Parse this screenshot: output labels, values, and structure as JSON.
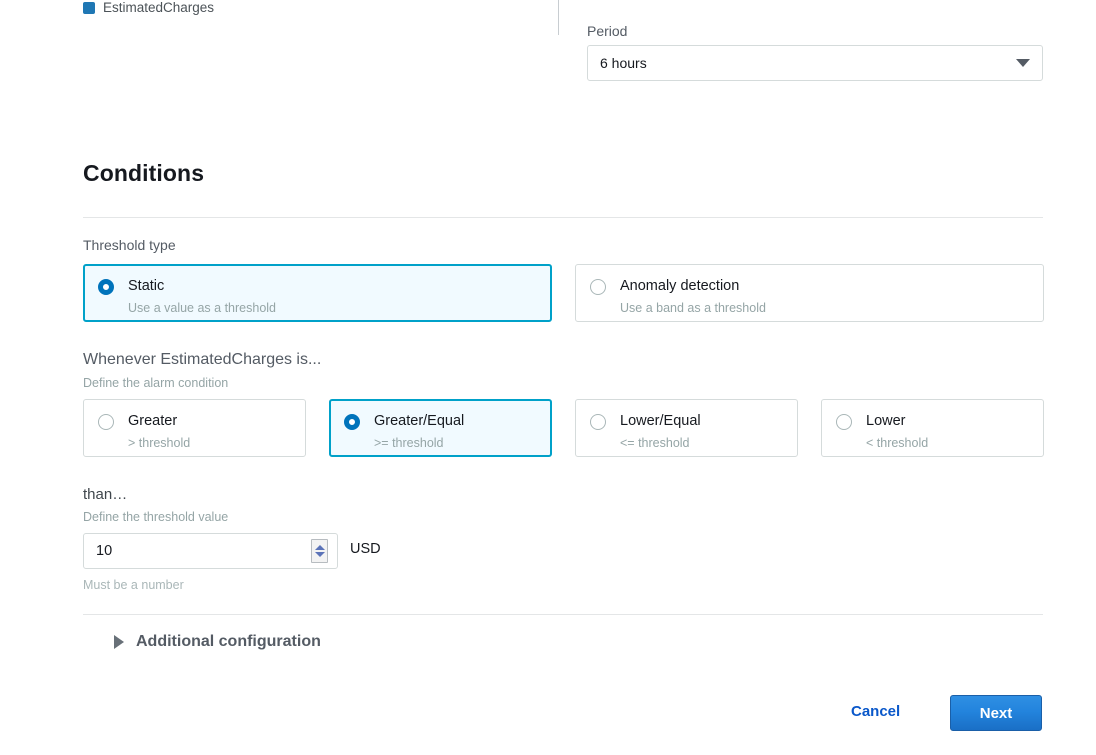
{
  "legend": {
    "label": "EstimatedCharges",
    "color": "#1f77b4"
  },
  "period": {
    "label": "Period",
    "value": "6 hours",
    "caret_icon": "chevron-down-icon"
  },
  "conditions": {
    "heading": "Conditions",
    "threshold_type": {
      "label": "Threshold type",
      "options": [
        {
          "title": "Static",
          "sub": "Use a value as a threshold",
          "selected": true
        },
        {
          "title": "Anomaly detection",
          "sub": "Use a band as a threshold",
          "selected": false
        }
      ]
    },
    "comparison": {
      "title": "Whenever EstimatedCharges is...",
      "sub": "Define the alarm condition",
      "options": [
        {
          "title": "Greater",
          "sub": "> threshold",
          "selected": false
        },
        {
          "title": "Greater/Equal",
          "sub": ">= threshold",
          "selected": true
        },
        {
          "title": "Lower/Equal",
          "sub": "<= threshold",
          "selected": false
        },
        {
          "title": "Lower",
          "sub": "< threshold",
          "selected": false
        }
      ]
    },
    "threshold_value": {
      "title": "than…",
      "sub": "Define the threshold value",
      "value": "10",
      "unit": "USD",
      "hint": "Must be a number"
    }
  },
  "additional_configuration": {
    "label": "Additional configuration",
    "caret_icon": "triangle-right-icon",
    "expanded": false
  },
  "footer": {
    "cancel_label": "Cancel",
    "next_label": "Next"
  },
  "colors": {
    "accent_blue": "#0073bb",
    "selected_border": "#00a1c9",
    "selected_fill": "#f1faff",
    "primary_button": "#2384dd",
    "link": "#0a58ca"
  }
}
